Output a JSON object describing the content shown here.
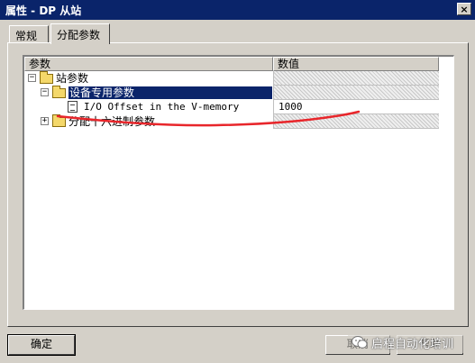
{
  "window": {
    "title": "属性 - DP 从站",
    "close_glyph": "×"
  },
  "tabs": [
    {
      "label": "常规",
      "active": false
    },
    {
      "label": "分配参数",
      "active": true
    }
  ],
  "table": {
    "columns": [
      "参数",
      "数值"
    ],
    "rows": [
      {
        "label": "站参数",
        "value": "",
        "expander": "−",
        "icon": "folder-open-icon"
      },
      {
        "label": "设备专用参数",
        "value": "",
        "expander": "−",
        "icon": "folder-open-icon",
        "selected": true
      },
      {
        "label": "I/O Offset in the V-memory",
        "value": "1000",
        "expander": "",
        "icon": "document-icon"
      },
      {
        "label": "分配十六进制参数",
        "value": "",
        "expander": "+",
        "icon": "folder-icon"
      }
    ]
  },
  "buttons": {
    "ok": "确定",
    "cancel": "取消",
    "help": "帮助"
  },
  "watermark": "启程自动化培训",
  "annotation_color": "#e8262b"
}
